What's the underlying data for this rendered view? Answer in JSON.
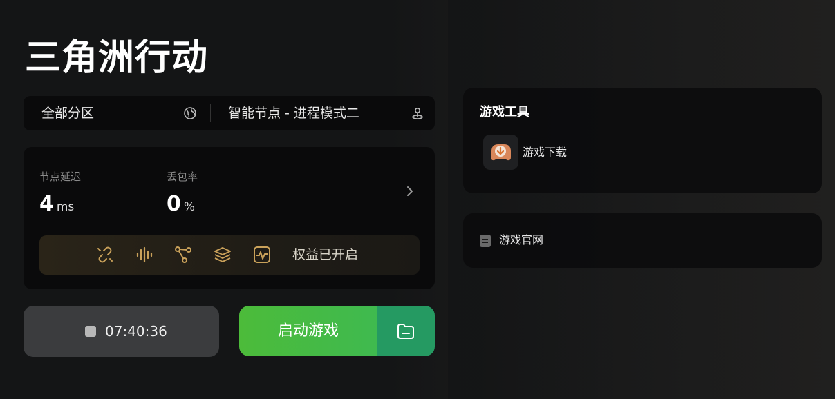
{
  "game": {
    "title": "三角洲行动"
  },
  "zone": {
    "region": "全部分区",
    "node": "智能节点 - 进程模式二"
  },
  "stats": {
    "latency_label": "节点延迟",
    "latency_value": "4",
    "latency_unit": "ms",
    "loss_label": "丢包率",
    "loss_value": "0",
    "loss_unit": "%"
  },
  "benefits": {
    "icons": [
      "link-icon",
      "waveform-icon",
      "route-icon",
      "layers-icon",
      "monitor-icon"
    ],
    "label": "权益已开启",
    "accent": "#c9a15a"
  },
  "actions": {
    "timer": "07:40:36",
    "launch_label": "启动游戏"
  },
  "tools": {
    "title": "游戏工具",
    "items": [
      {
        "label": "游戏下载",
        "icon": "download-icon"
      }
    ]
  },
  "website": {
    "label": "游戏官网",
    "icon": "document-icon"
  },
  "colors": {
    "launch_green": "#4cbb3a",
    "folder_green": "#259a62",
    "card_bg": "#0a0a0b"
  }
}
